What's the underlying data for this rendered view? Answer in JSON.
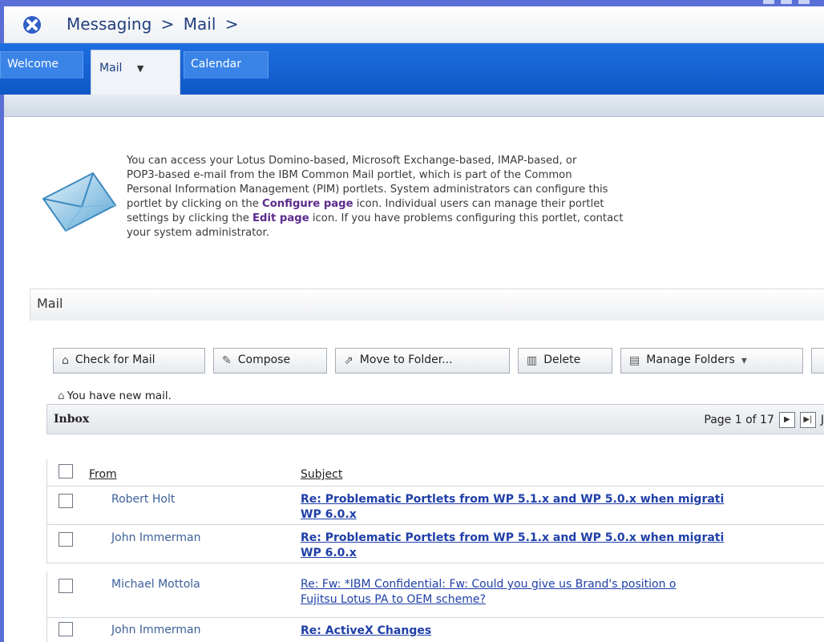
{
  "breadcrumb": {
    "items": [
      "Messaging",
      ">",
      "Mail",
      ">"
    ]
  },
  "tabs": {
    "welcome": "Welcome",
    "mail": "Mail",
    "calendar": "Calendar"
  },
  "intro": {
    "line1": "You can access your Lotus Domino-based, Microsoft Exchange-based, IMAP-based, or",
    "line2": "POP3-based e-mail from the IBM Common Mail portlet, which is part of the Common",
    "line3": "Personal Information Management (PIM) portlets. System administrators can configure this",
    "line4_pre": "portlet by clicking on the ",
    "line4_link": "Configure page",
    "line4_post": " icon. Individual users can manage their portlet",
    "line5_pre": "settings by clicking the ",
    "line5_link": "Edit page",
    "line5_post": " icon. If you have problems configuring this portlet, contact",
    "line6": "your system administrator."
  },
  "portlet": {
    "title": "Mail"
  },
  "toolbar": {
    "check_mail": "Check for Mail",
    "compose": "Compose",
    "move_to_folder": "Move to Folder...",
    "delete": "Delete",
    "manage_folders": "Manage Folders"
  },
  "notice": "You have new mail.",
  "inbox": {
    "title": "Inbox",
    "pager_text": "Page 1 of 17",
    "pager_trailing": "J",
    "columns": {
      "from": "From",
      "subject": "Subject"
    },
    "rows": [
      {
        "from": "Robert Holt",
        "subject_line1": "Re: Problematic Portlets from WP 5.1.x and WP 5.0.x when migrati",
        "subject_line2": "WP 6.0.x",
        "unread": true
      },
      {
        "from": "John Immerman",
        "subject_line1": "Re: Problematic Portlets from WP 5.1.x and WP 5.0.x when migrati",
        "subject_line2": "WP 6.0.x",
        "unread": true
      },
      {
        "from": "Michael Mottola",
        "subject_line1": "Re: Fw: *IBM Confidential: Fw: Could you give us Brand's position o",
        "subject_line2": "Fujitsu Lotus PA to OEM scheme?",
        "unread": false
      },
      {
        "from": "John Immerman",
        "subject_line1": "Re: ActiveX Changes",
        "subject_line2": "",
        "unread": true
      }
    ]
  }
}
